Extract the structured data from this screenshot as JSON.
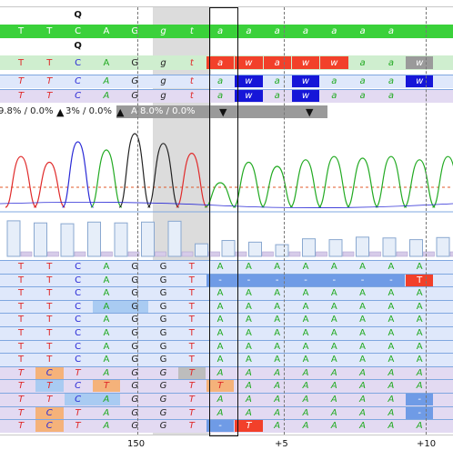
{
  "colors": {
    "top_bar": "#3ad13a",
    "ref_row": "#cfeecf",
    "amb_red": "#f2402a",
    "amb_blue": "#1616d8",
    "amb_gray": "#9a9a9a",
    "row_blue": "#dfe8fb",
    "row_purple": "#e3daf2",
    "row_line": "#7fa7e0",
    "shade": "#dcdcdc",
    "sel_box": "#111111",
    "base_T": "#e02a2a",
    "base_C": "#2a2ad6",
    "base_A": "#22aa22",
    "base_G": "#222222",
    "hl_orange": "#f5b27a",
    "hl_lightblue": "#a9cbf2",
    "hl_blue": "#6f9be6",
    "hl_red": "#f2402a",
    "hl_gray": "#bdbdbd",
    "mid_line": "#e05a2a",
    "bar_fill": "#e6eef9",
    "bar_stroke": "#8aa8d0"
  },
  "aa_labels": [
    {
      "text": "Q",
      "col": 2
    },
    {
      "text": "Q",
      "col": 2
    }
  ],
  "ruler": {
    "labels": [
      "150",
      "+5",
      "+10"
    ]
  },
  "tracks": {
    "top": [
      "T",
      "T",
      "C",
      "A",
      "G",
      "g",
      "t",
      "a",
      "a",
      "a",
      "a",
      "a",
      "a",
      "a"
    ],
    "ref": [
      "T",
      "T",
      "C",
      "A",
      "G",
      "g",
      "t",
      "a",
      "w",
      "a",
      "w",
      "w",
      "a",
      "a",
      "w"
    ],
    "read1": [
      "T",
      "T",
      "C",
      "A",
      "G",
      "g",
      "t",
      "a",
      "w",
      "a",
      "w",
      "a",
      "a",
      "a",
      "w"
    ],
    "read2": [
      "T",
      "T",
      "C",
      "A",
      "G",
      "g",
      "t",
      "a",
      "w",
      "a",
      "w",
      "a",
      "a",
      "a"
    ]
  },
  "stats": {
    "seg1": "9.8% / 0.0%",
    "seg2": "3% / 0.0%",
    "seg3": "A  8.0% / 0.0%",
    "arrows": [
      "▲",
      "▲",
      "▼",
      "▼"
    ]
  },
  "chromatogram": {
    "peaks": [
      {
        "col": 0,
        "base": "T",
        "h": 0.62
      },
      {
        "col": 1,
        "base": "T",
        "h": 0.55
      },
      {
        "col": 2,
        "base": "C",
        "h": 0.8
      },
      {
        "col": 3,
        "base": "A",
        "h": 0.7
      },
      {
        "col": 4,
        "base": "G",
        "h": 0.9
      },
      {
        "col": 5,
        "base": "G",
        "h": 0.78
      },
      {
        "col": 6,
        "base": "T",
        "h": 0.66
      },
      {
        "col": 7,
        "base": "A",
        "h": 0.3
      },
      {
        "col": 8,
        "base": "A",
        "h": 0.55
      },
      {
        "col": 9,
        "base": "A",
        "h": 0.5
      },
      {
        "col": 10,
        "base": "A",
        "h": 0.58
      },
      {
        "col": 11,
        "base": "A",
        "h": 0.62
      },
      {
        "col": 12,
        "base": "A",
        "h": 0.6
      },
      {
        "col": 13,
        "base": "A",
        "h": 0.62
      },
      {
        "col": 14,
        "base": "A",
        "h": 0.58
      },
      {
        "col": 15,
        "base": "A",
        "h": 0.62
      }
    ]
  },
  "quality_bars": [
    0.85,
    0.8,
    0.78,
    0.82,
    0.8,
    0.82,
    0.84,
    0.3,
    0.38,
    0.34,
    0.28,
    0.42,
    0.4,
    0.46,
    0.44,
    0.4,
    0.45
  ],
  "reads": [
    {
      "bg": "blue",
      "bases": [
        "T",
        "T",
        "C",
        "A",
        "G",
        "G",
        "T",
        "A",
        "A",
        "A",
        "A",
        "A",
        "A",
        "A",
        "A"
      ],
      "ital": false
    },
    {
      "bg": "blue",
      "bases": [
        "T",
        "T",
        "C",
        "A",
        "G",
        "G",
        "T",
        "-",
        "-",
        "-",
        "-",
        "-",
        "-",
        "-",
        "T"
      ],
      "ital": false,
      "hl": [
        {
          "from": 7,
          "to": 13,
          "c": "hl_blue"
        },
        {
          "from": 14,
          "to": 14,
          "c": "hl_red"
        }
      ]
    },
    {
      "bg": "blue",
      "bases": [
        "T",
        "T",
        "C",
        "A",
        "G",
        "G",
        "T",
        "A",
        "A",
        "A",
        "A",
        "A",
        "A",
        "A",
        "A"
      ],
      "ital": false
    },
    {
      "bg": "blue",
      "bases": [
        "T",
        "T",
        "C",
        "A",
        "G",
        "G",
        "T",
        "A",
        "A",
        "A",
        "A",
        "A",
        "A",
        "A",
        "A"
      ],
      "ital": false,
      "hl": [
        {
          "from": 3,
          "to": 4,
          "c": "hl_lightblue"
        }
      ]
    },
    {
      "bg": "blue",
      "bases": [
        "T",
        "T",
        "C",
        "A",
        "G",
        "G",
        "T",
        "A",
        "A",
        "A",
        "A",
        "A",
        "A",
        "A",
        "A"
      ],
      "ital": false
    },
    {
      "bg": "blue",
      "bases": [
        "T",
        "T",
        "C",
        "A",
        "G",
        "G",
        "T",
        "A",
        "A",
        "A",
        "A",
        "A",
        "A",
        "A",
        "A"
      ],
      "ital": false
    },
    {
      "bg": "blue",
      "bases": [
        "T",
        "T",
        "C",
        "A",
        "G",
        "G",
        "T",
        "A",
        "A",
        "A",
        "A",
        "A",
        "A",
        "A",
        "A"
      ],
      "ital": false
    },
    {
      "bg": "blue",
      "bases": [
        "T",
        "T",
        "C",
        "A",
        "G",
        "G",
        "T",
        "A",
        "A",
        "A",
        "A",
        "A",
        "A",
        "A",
        "A"
      ],
      "ital": false
    },
    {
      "bg": "purple",
      "bases": [
        "T",
        "C",
        "T",
        "A",
        "G",
        "G",
        "T",
        "A",
        "A",
        "A",
        "A",
        "A",
        "A",
        "A",
        "A"
      ],
      "ital": true,
      "hl": [
        {
          "from": 1,
          "to": 1,
          "c": "hl_orange"
        },
        {
          "from": 6,
          "to": 6,
          "c": "hl_gray"
        }
      ]
    },
    {
      "bg": "purple",
      "bases": [
        "T",
        "T",
        "C",
        "T",
        "G",
        "G",
        "T",
        "T",
        "A",
        "A",
        "A",
        "A",
        "A",
        "A",
        "A"
      ],
      "ital": true,
      "hl": [
        {
          "from": 1,
          "to": 1,
          "c": "hl_lightblue"
        },
        {
          "from": 3,
          "to": 3,
          "c": "hl_orange"
        },
        {
          "from": 7,
          "to": 7,
          "c": "hl_orange"
        }
      ]
    },
    {
      "bg": "purple",
      "bases": [
        "T",
        "T",
        "C",
        "A",
        "G",
        "G",
        "T",
        "A",
        "A",
        "A",
        "A",
        "A",
        "A",
        "A",
        "-"
      ],
      "ital": true,
      "hl": [
        {
          "from": 2,
          "to": 3,
          "c": "hl_lightblue"
        },
        {
          "from": 14,
          "to": 14,
          "c": "hl_blue"
        }
      ]
    },
    {
      "bg": "purple",
      "bases": [
        "T",
        "C",
        "T",
        "A",
        "G",
        "G",
        "T",
        "A",
        "A",
        "A",
        "A",
        "A",
        "A",
        "A",
        "-"
      ],
      "ital": true,
      "hl": [
        {
          "from": 1,
          "to": 1,
          "c": "hl_orange"
        },
        {
          "from": 14,
          "to": 14,
          "c": "hl_blue"
        }
      ]
    },
    {
      "bg": "purple",
      "bases": [
        "T",
        "C",
        "T",
        "A",
        "G",
        "G",
        "T",
        "-",
        "T",
        "A",
        "A",
        "A",
        "A",
        "A",
        "A"
      ],
      "ital": true,
      "hl": [
        {
          "from": 1,
          "to": 1,
          "c": "hl_orange"
        },
        {
          "from": 7,
          "to": 7,
          "c": "hl_blue"
        },
        {
          "from": 8,
          "to": 8,
          "c": "hl_red"
        }
      ]
    }
  ]
}
